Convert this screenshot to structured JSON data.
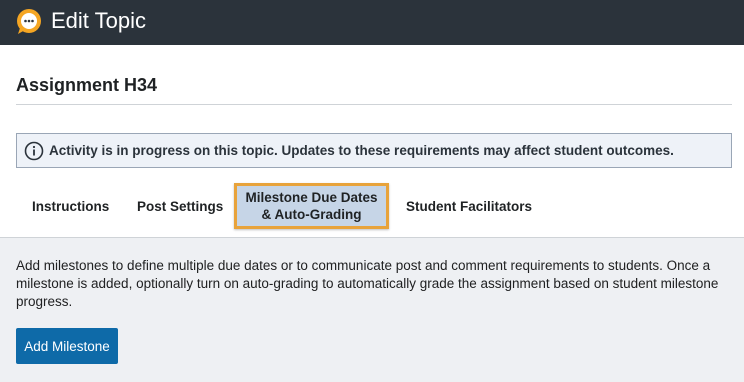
{
  "header": {
    "title": "Edit Topic",
    "icon": "chat-bubble-icon",
    "background": "#2b333b"
  },
  "topic": {
    "title": "Assignment H34"
  },
  "alert": {
    "icon": "info-circle-icon",
    "text": "Activity is in progress on this topic. Updates to these requirements may affect student outcomes."
  },
  "tabs": [
    {
      "label": "Instructions",
      "selected": false
    },
    {
      "label": "Post Settings",
      "selected": false
    },
    {
      "label_line1": "Milestone Due Dates",
      "label_line2": "& Auto-Grading",
      "selected": true
    },
    {
      "label": "Student Facilitators",
      "selected": false
    }
  ],
  "panel": {
    "description": "Add milestones to define multiple due dates or to communicate post and comment requirements to students. Once a milestone is added, optionally turn on auto-grading to automatically grade the assignment based on student milestone progress.",
    "add_button_label": "Add Milestone"
  },
  "colors": {
    "accent": "#0e6aa8",
    "tab_focus_border": "#e8a33b",
    "selected_tab_bg": "#c6d5e7"
  }
}
